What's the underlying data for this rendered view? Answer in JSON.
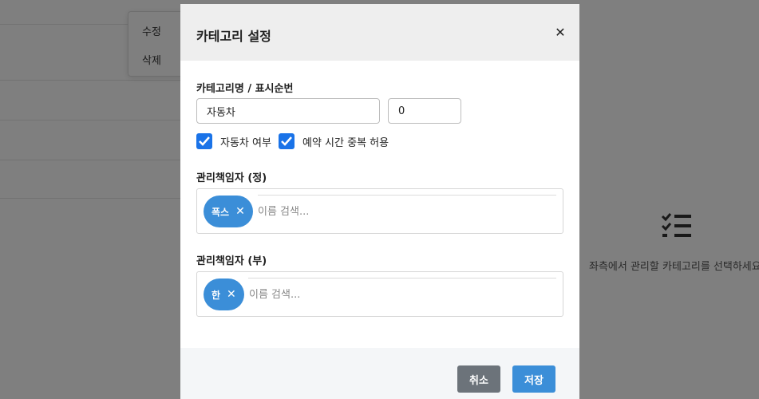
{
  "background": {
    "context_menu": {
      "edit_label": "수정",
      "delete_label": "삭제"
    },
    "empty_state": {
      "icon": "checklist-icon",
      "text": "좌측에서 관리할 카테고리를 선택하세요"
    }
  },
  "modal": {
    "title": "카테고리 설정",
    "close_icon": "close-icon",
    "name_order_label": "카테고리명 / 표시순번",
    "category_name_value": "자동차",
    "display_order_value": "0",
    "checkboxes": [
      {
        "label": "자동차 여부",
        "checked": true
      },
      {
        "label": "예약 시간 중복 허용",
        "checked": true
      }
    ],
    "primary_manager": {
      "label": "관리책임자 (정)",
      "chips": [
        {
          "text": "폭스"
        }
      ],
      "search_placeholder": "이름 검색..."
    },
    "secondary_manager": {
      "label": "관리책임자 (부)",
      "chips": [
        {
          "text": "한"
        }
      ],
      "search_placeholder": "이름 검색..."
    },
    "footer": {
      "cancel_label": "취소",
      "save_label": "저장"
    }
  },
  "colors": {
    "accent": "#3b8ed8",
    "checkbox": "#1a73e8",
    "cancel": "#6c737a",
    "backdrop": "rgba(0,0,0,0.5)"
  }
}
